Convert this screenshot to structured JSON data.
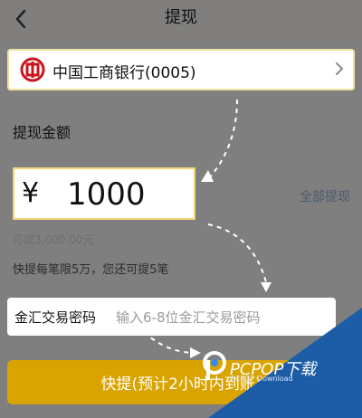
{
  "header": {
    "title": "提现",
    "back_icon": "chevron-left-icon"
  },
  "bank": {
    "name": "中国工商银行(0005)",
    "icon": "icbc-bank-icon",
    "chevron": "chevron-right-icon"
  },
  "withdrawal": {
    "section_title": "提现金额",
    "currency_symbol": "¥",
    "amount": "1000",
    "all_withdraw_label": "全部提现",
    "available_text": "可提3,000.00元",
    "limit_text": "快提每笔限5万，您还可提5笔"
  },
  "password": {
    "label": "金汇交易密码",
    "placeholder": "输入6-8位金汇交易密码"
  },
  "submit": {
    "label": "快提(预计2小时内到账)"
  },
  "watermark": {
    "brand": "PCPOP下载",
    "subtext": "PCPOP Download"
  },
  "colors": {
    "overlay": "#7f7f7f",
    "accent": "#f2b400",
    "highlight_border": "#f0d673",
    "watermark_blue": "#1d5da8"
  }
}
